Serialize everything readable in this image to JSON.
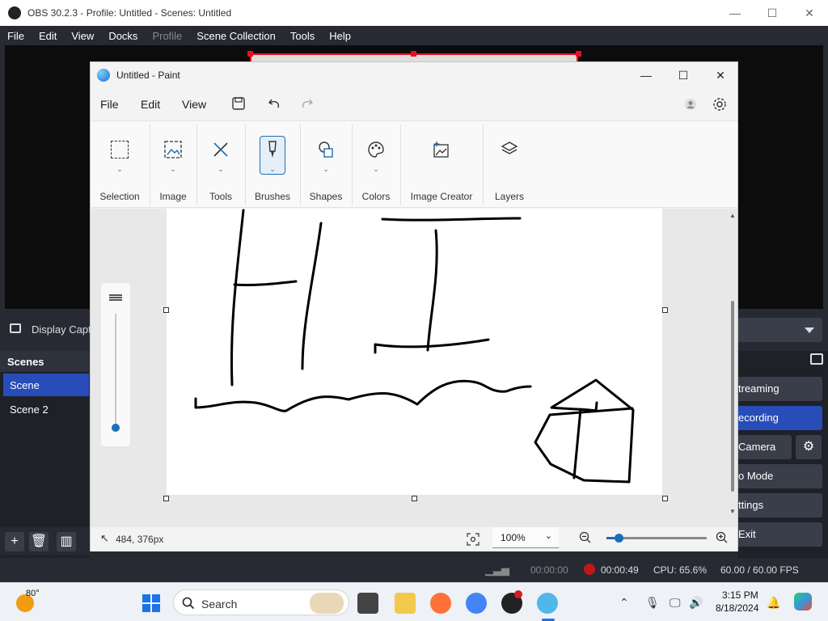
{
  "obs": {
    "title": "OBS 30.2.3 - Profile: Untitled - Scenes: Untitled",
    "menu": [
      "File",
      "Edit",
      "View",
      "Docks",
      "Profile",
      "Scene Collection",
      "Tools",
      "Help"
    ],
    "source_label": "Display Capt",
    "scenes_header": "Scenes",
    "scenes": [
      "Scene",
      "Scene 2"
    ],
    "controls": [
      "treaming",
      "ecording",
      "Camera",
      "o Mode",
      "ttings",
      "Exit"
    ],
    "status": {
      "stream_time": "00:00:00",
      "rec_time": "00:00:49",
      "cpu": "CPU: 65.6%",
      "fps": "60.00 / 60.00 FPS"
    }
  },
  "paint": {
    "title": "Untitled - Paint",
    "menu": [
      "File",
      "Edit",
      "View"
    ],
    "ribbon": [
      "Selection",
      "Image",
      "Tools",
      "Brushes",
      "Shapes",
      "Colors",
      "Image Creator",
      "Layers"
    ],
    "position": "484, 376px",
    "zoom": "100%",
    "zoom_level_fraction": 0.12,
    "brush_size_fraction": 0.0
  },
  "taskbar": {
    "weather_temp": "80°",
    "search_placeholder": "Search",
    "time": "3:15 PM",
    "date": "8/18/2024"
  },
  "colors": {
    "accent": "#284cb8",
    "recording": "#c01616",
    "paint_accent": "#1b6fb8"
  }
}
